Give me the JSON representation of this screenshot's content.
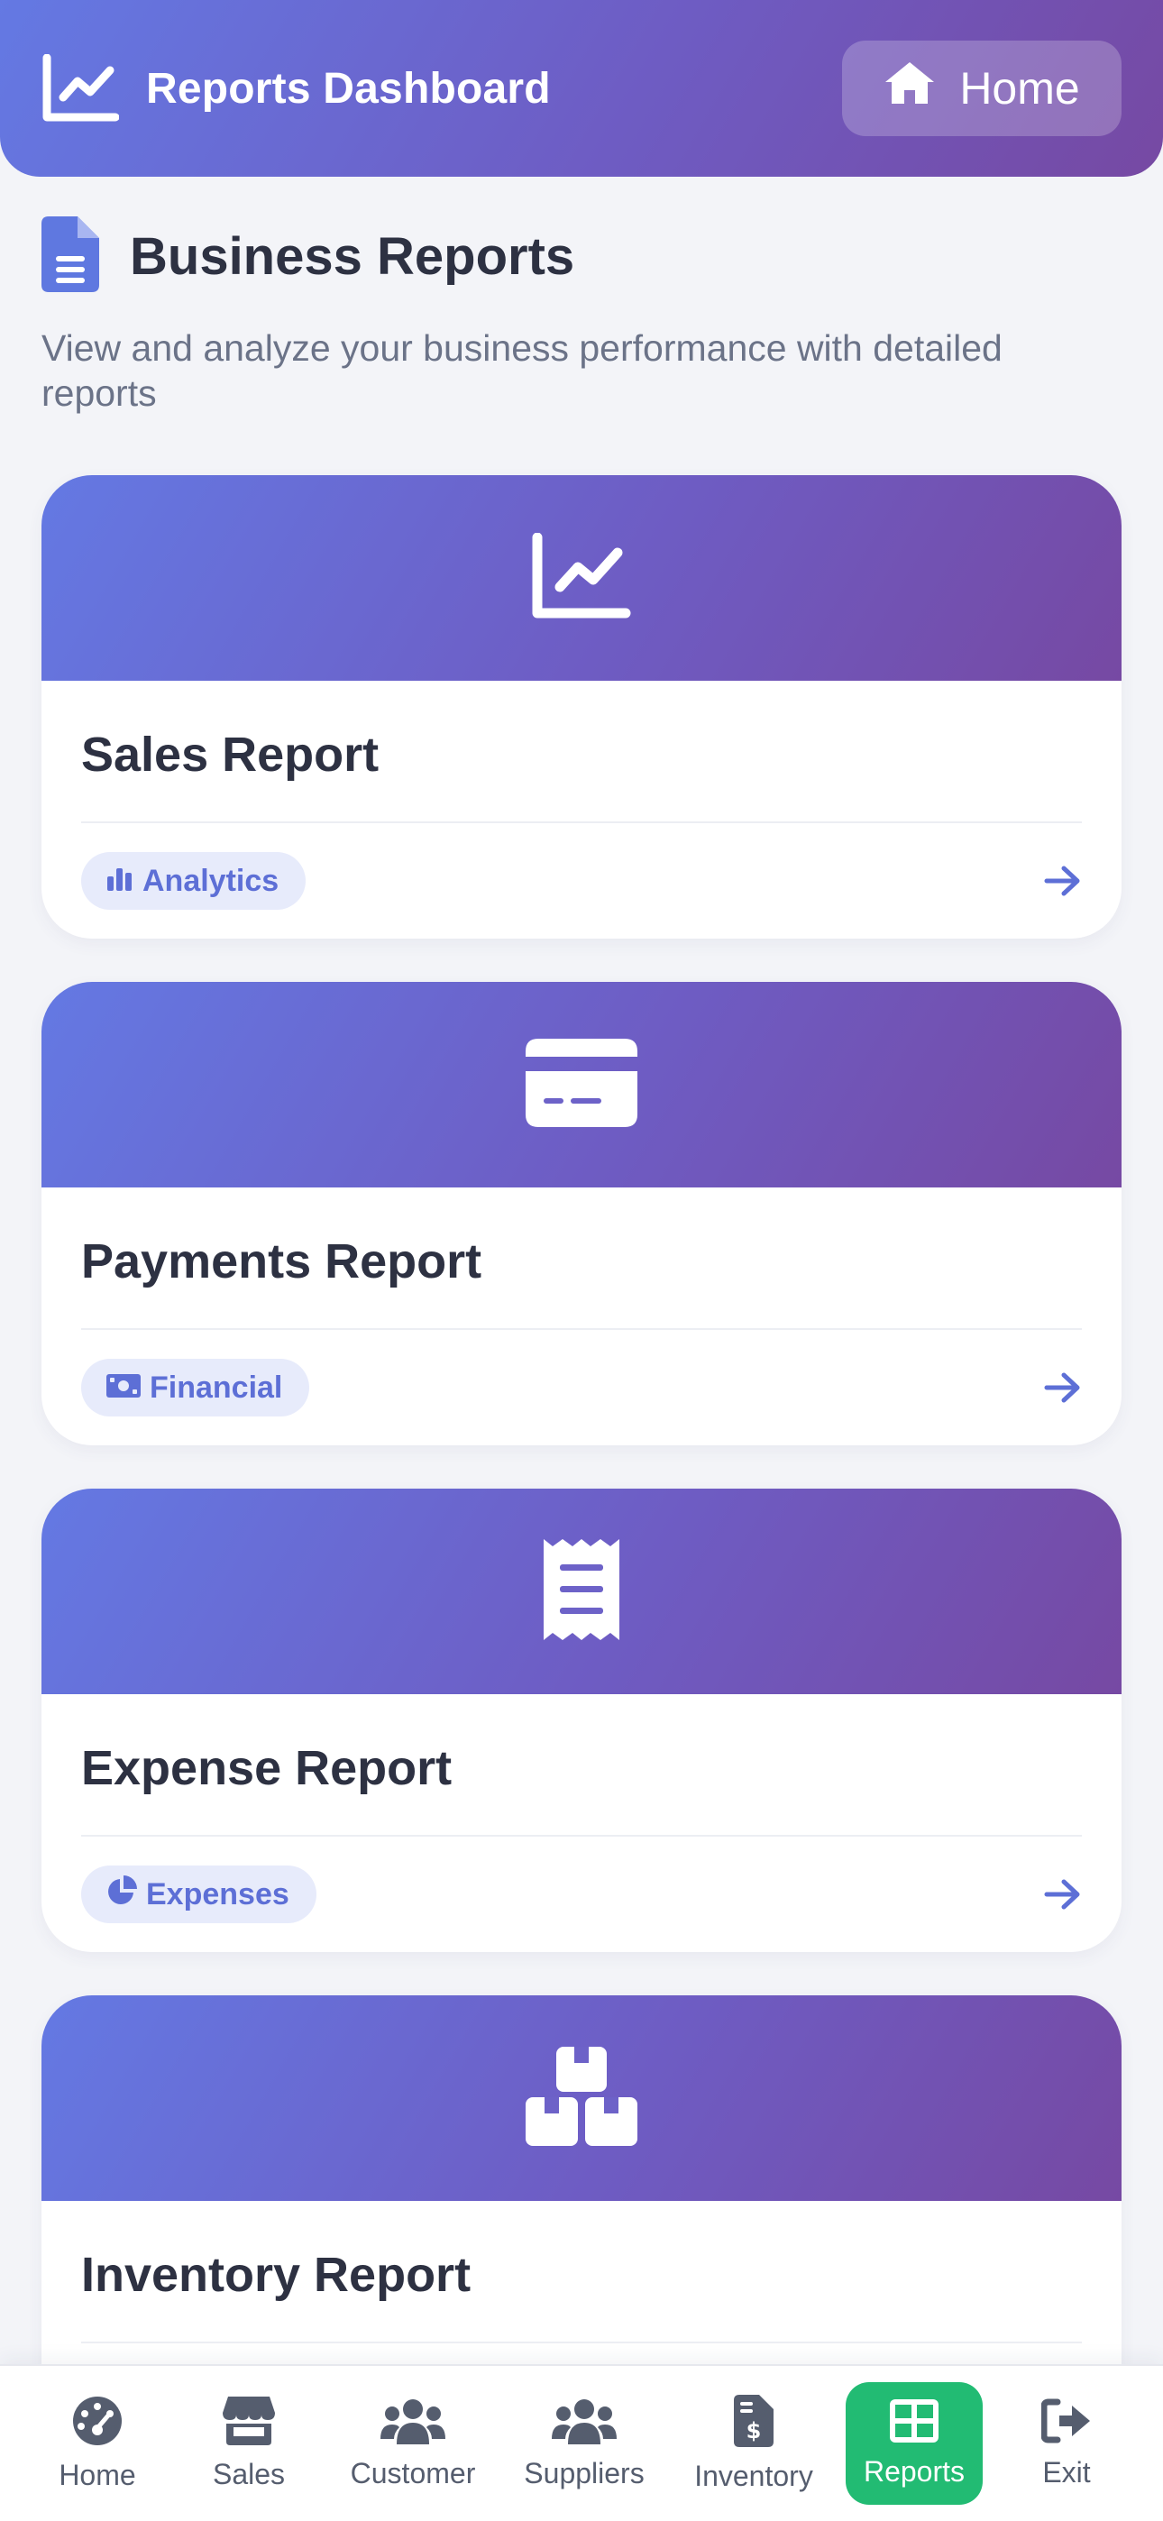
{
  "header": {
    "title": "Reports Dashboard",
    "logo_icon": "chart-line-icon",
    "home_label": "Home",
    "home_icon": "house-icon"
  },
  "page": {
    "title": "Business Reports",
    "title_icon": "file-document-icon",
    "subtitle": "View and analyze your business performance with detailed reports"
  },
  "cards": [
    {
      "title": "Sales Report",
      "icon": "chart-line-icon",
      "badge": "Analytics",
      "badge_icon": "bar-chart-icon"
    },
    {
      "title": "Payments Report",
      "icon": "credit-card-icon",
      "badge": "Financial",
      "badge_icon": "money-bill-icon"
    },
    {
      "title": "Expense Report",
      "icon": "receipt-icon",
      "badge": "Expenses",
      "badge_icon": "pie-chart-icon"
    },
    {
      "title": "Inventory Report",
      "icon": "boxes-icon",
      "badge": "",
      "badge_icon": ""
    }
  ],
  "nav": [
    {
      "label": "Home",
      "icon": "gauge-icon",
      "active": false
    },
    {
      "label": "Sales",
      "icon": "store-icon",
      "active": false
    },
    {
      "label": "Customer",
      "icon": "users-icon",
      "active": false
    },
    {
      "label": "Suppliers",
      "icon": "users-icon",
      "active": false
    },
    {
      "label": "Inventory",
      "icon": "file-invoice-dollar-icon",
      "active": false
    },
    {
      "label": "Reports",
      "icon": "table-icon",
      "active": true
    },
    {
      "label": "Exit",
      "icon": "sign-out-icon",
      "active": false
    }
  ],
  "colors": {
    "gradient_start": "#6479e3",
    "gradient_end": "#7649a3",
    "accent": "#5d6fd6",
    "active_nav": "#22bb73",
    "background": "#f3f4f8"
  }
}
